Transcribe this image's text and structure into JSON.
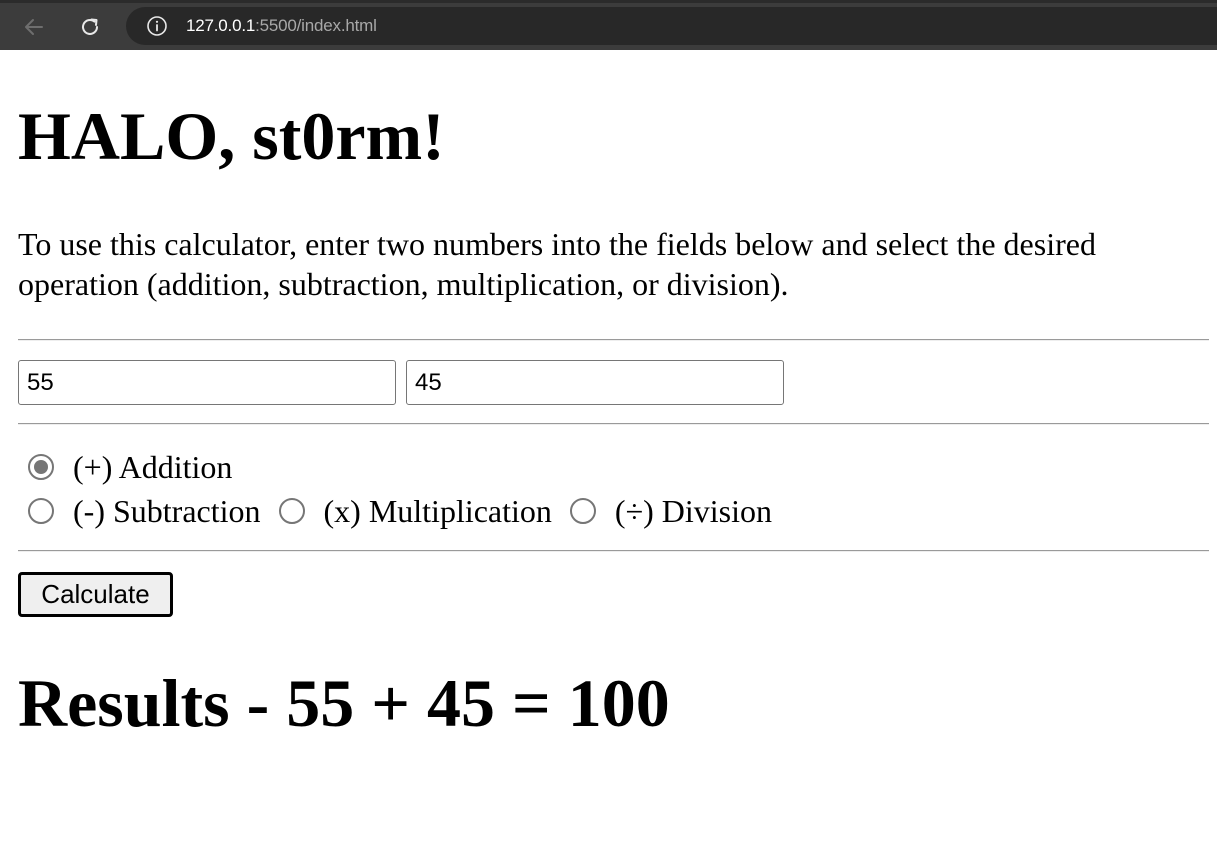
{
  "browser": {
    "url_host": "127.0.0.1",
    "url_rest": ":5500/index.html",
    "back_icon": "arrow-left-icon",
    "reload_icon": "reload-icon",
    "info_icon": "info-icon"
  },
  "page": {
    "title": "HALO, st0rm!",
    "instructions": "To use this calculator, enter two numbers into the fields below and select the desired operation (addition, subtraction, multiplication, or division)."
  },
  "inputs": {
    "first_value": "55",
    "second_value": "45"
  },
  "operations": [
    {
      "label": "(+) Addition",
      "selected": true
    },
    {
      "label": "(-) Subtraction",
      "selected": false
    },
    {
      "label": "(x) Multiplication",
      "selected": false
    },
    {
      "label": "(÷) Division",
      "selected": false
    }
  ],
  "calculate_label": "Calculate",
  "results": "Results - 55 + 45 = 100",
  "colors": {
    "browser_bar": "#3c3c3c",
    "address_bar": "#282828",
    "radio_checked": "#767676"
  }
}
